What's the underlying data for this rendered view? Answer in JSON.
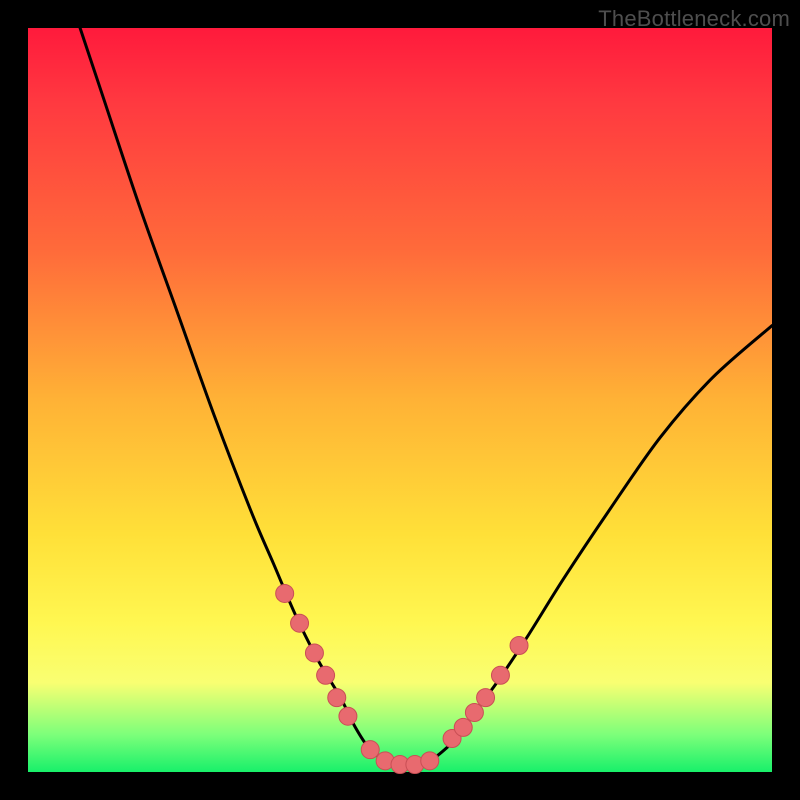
{
  "watermark": "TheBottleneck.com",
  "colors": {
    "background": "#000000",
    "gradient_top": "#ff1a3c",
    "gradient_bottom": "#18f06a",
    "curve": "#000000",
    "marker_fill": "#e86a6f",
    "marker_stroke": "#c94f55"
  },
  "chart_data": {
    "type": "line",
    "title": "",
    "xlabel": "",
    "ylabel": "",
    "xlim": [
      0,
      100
    ],
    "ylim": [
      0,
      100
    ],
    "grid": false,
    "note": "No axis ticks or numeric labels are rendered; values estimated from pixel positions on a 0–100 normalized scale (x left→right, y = curve height from bottom).",
    "series": [
      {
        "name": "bottleneck-curve",
        "x": [
          7,
          10,
          15,
          20,
          25,
          30,
          33,
          36,
          39,
          42,
          44,
          46,
          48,
          50,
          52,
          54,
          56,
          58,
          60,
          63,
          67,
          72,
          78,
          85,
          92,
          100
        ],
        "y": [
          100,
          91,
          76,
          62,
          48,
          35,
          28,
          21,
          15,
          10,
          6,
          3,
          1.5,
          1,
          1,
          1.5,
          3,
          5,
          8,
          12,
          18,
          26,
          35,
          45,
          53,
          60
        ]
      }
    ],
    "markers": {
      "name": "highlight-points",
      "x": [
        34.5,
        36.5,
        38.5,
        40.0,
        41.5,
        43.0,
        46.0,
        48.0,
        50.0,
        52.0,
        54.0,
        57.0,
        58.5,
        60.0,
        61.5,
        63.5,
        66.0
      ],
      "y": [
        24.0,
        20.0,
        16.0,
        13.0,
        10.0,
        7.5,
        3.0,
        1.5,
        1.0,
        1.0,
        1.5,
        4.5,
        6.0,
        8.0,
        10.0,
        13.0,
        17.0
      ]
    }
  }
}
